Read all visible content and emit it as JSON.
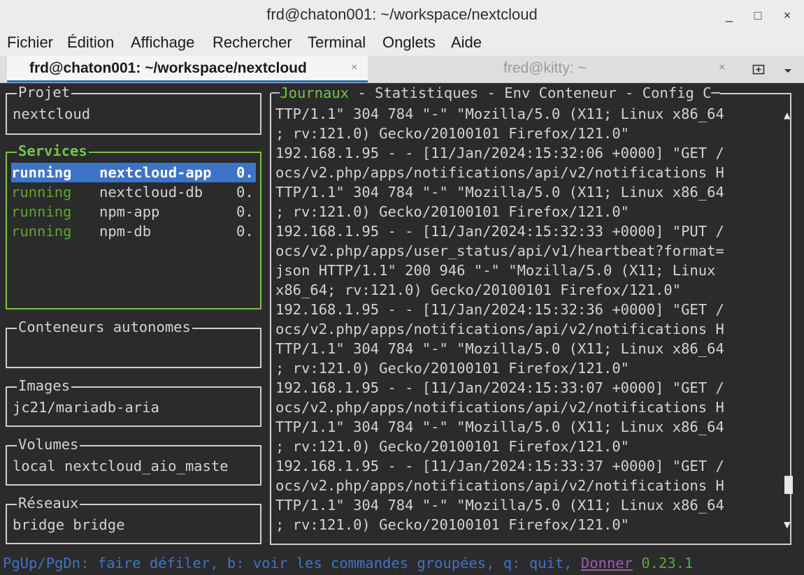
{
  "window": {
    "title": "frd@chaton001: ~/workspace/nextcloud",
    "minimize": "_",
    "maximize": "□",
    "close": "×"
  },
  "menu": [
    "Fichier",
    "Édition",
    "Affichage",
    "Rechercher",
    "Terminal",
    "Onglets",
    "Aide"
  ],
  "tabs": [
    {
      "label": "frd@chaton001: ~/workspace/nextcloud",
      "close": "×"
    },
    {
      "label": "fred@kitty: ~",
      "close": "×"
    }
  ],
  "tabbar_icons": {
    "new_tab": "new-tab-icon",
    "dropdown": "chevron-down-icon"
  },
  "panels": {
    "projet": {
      "title": "Projet",
      "value": "nextcloud"
    },
    "services": {
      "title": "Services",
      "rows": [
        {
          "status": "running",
          "name": "nextcloud-app",
          "value": "0."
        },
        {
          "status": "running",
          "name": "nextcloud-db",
          "value": "0."
        },
        {
          "status": "running",
          "name": "npm-app",
          "value": "0."
        },
        {
          "status": "running",
          "name": "npm-db",
          "value": "0."
        }
      ]
    },
    "conteneurs": {
      "title": "Conteneurs autonomes"
    },
    "images": {
      "title": "Images",
      "value": "jc21/mariadb-aria"
    },
    "volumes": {
      "title": "Volumes",
      "value": "local nextcloud_aio_maste"
    },
    "reseaux": {
      "title": "Réseaux",
      "value": "bridge bridge"
    }
  },
  "logpanel": {
    "tabs": [
      "Journaux",
      "Statistiques",
      "Env Conteneur",
      "Config C"
    ],
    "separator": " - ",
    "lines": [
      "TTP/1.1\" 304 784 \"-\" \"Mozilla/5.0 (X11; Linux x86_64",
      "; rv:121.0) Gecko/20100101 Firefox/121.0\"",
      "192.168.1.95 - - [11/Jan/2024:15:32:06 +0000] \"GET /",
      "ocs/v2.php/apps/notifications/api/v2/notifications H",
      "TTP/1.1\" 304 784 \"-\" \"Mozilla/5.0 (X11; Linux x86_64",
      "; rv:121.0) Gecko/20100101 Firefox/121.0\"",
      "192.168.1.95 - - [11/Jan/2024:15:32:33 +0000] \"PUT /",
      "ocs/v2.php/apps/user_status/api/v1/heartbeat?format=",
      "json HTTP/1.1\" 200 946 \"-\" \"Mozilla/5.0 (X11; Linux",
      "x86_64; rv:121.0) Gecko/20100101 Firefox/121.0\"",
      "192.168.1.95 - - [11/Jan/2024:15:32:36 +0000] \"GET /",
      "ocs/v2.php/apps/notifications/api/v2/notifications H",
      "TTP/1.1\" 304 784 \"-\" \"Mozilla/5.0 (X11; Linux x86_64",
      "; rv:121.0) Gecko/20100101 Firefox/121.0\"",
      "192.168.1.95 - - [11/Jan/2024:15:33:07 +0000] \"GET /",
      "ocs/v2.php/apps/notifications/api/v2/notifications H",
      "TTP/1.1\" 304 784 \"-\" \"Mozilla/5.0 (X11; Linux x86_64",
      "; rv:121.0) Gecko/20100101 Firefox/121.0\"",
      "192.168.1.95 - - [11/Jan/2024:15:33:37 +0000] \"GET /",
      "ocs/v2.php/apps/notifications/api/v2/notifications H",
      "TTP/1.1\" 304 784 \"-\" \"Mozilla/5.0 (X11; Linux x86_64",
      "; rv:121.0) Gecko/20100101 Firefox/121.0\""
    ],
    "scroll_position": 0.9
  },
  "statusbar": {
    "help": "PgUp/PgDn: faire défiler, b: voir les commandes groupées, q: quit, ",
    "donate": "Donner",
    "version": "0.23.1"
  },
  "colors": {
    "accent_green": "#76c44a",
    "status_green": "#5ea634",
    "selection_blue": "#3d74c7",
    "donate_purple": "#9b59b6",
    "terminal_bg": "#2b2b2b"
  }
}
